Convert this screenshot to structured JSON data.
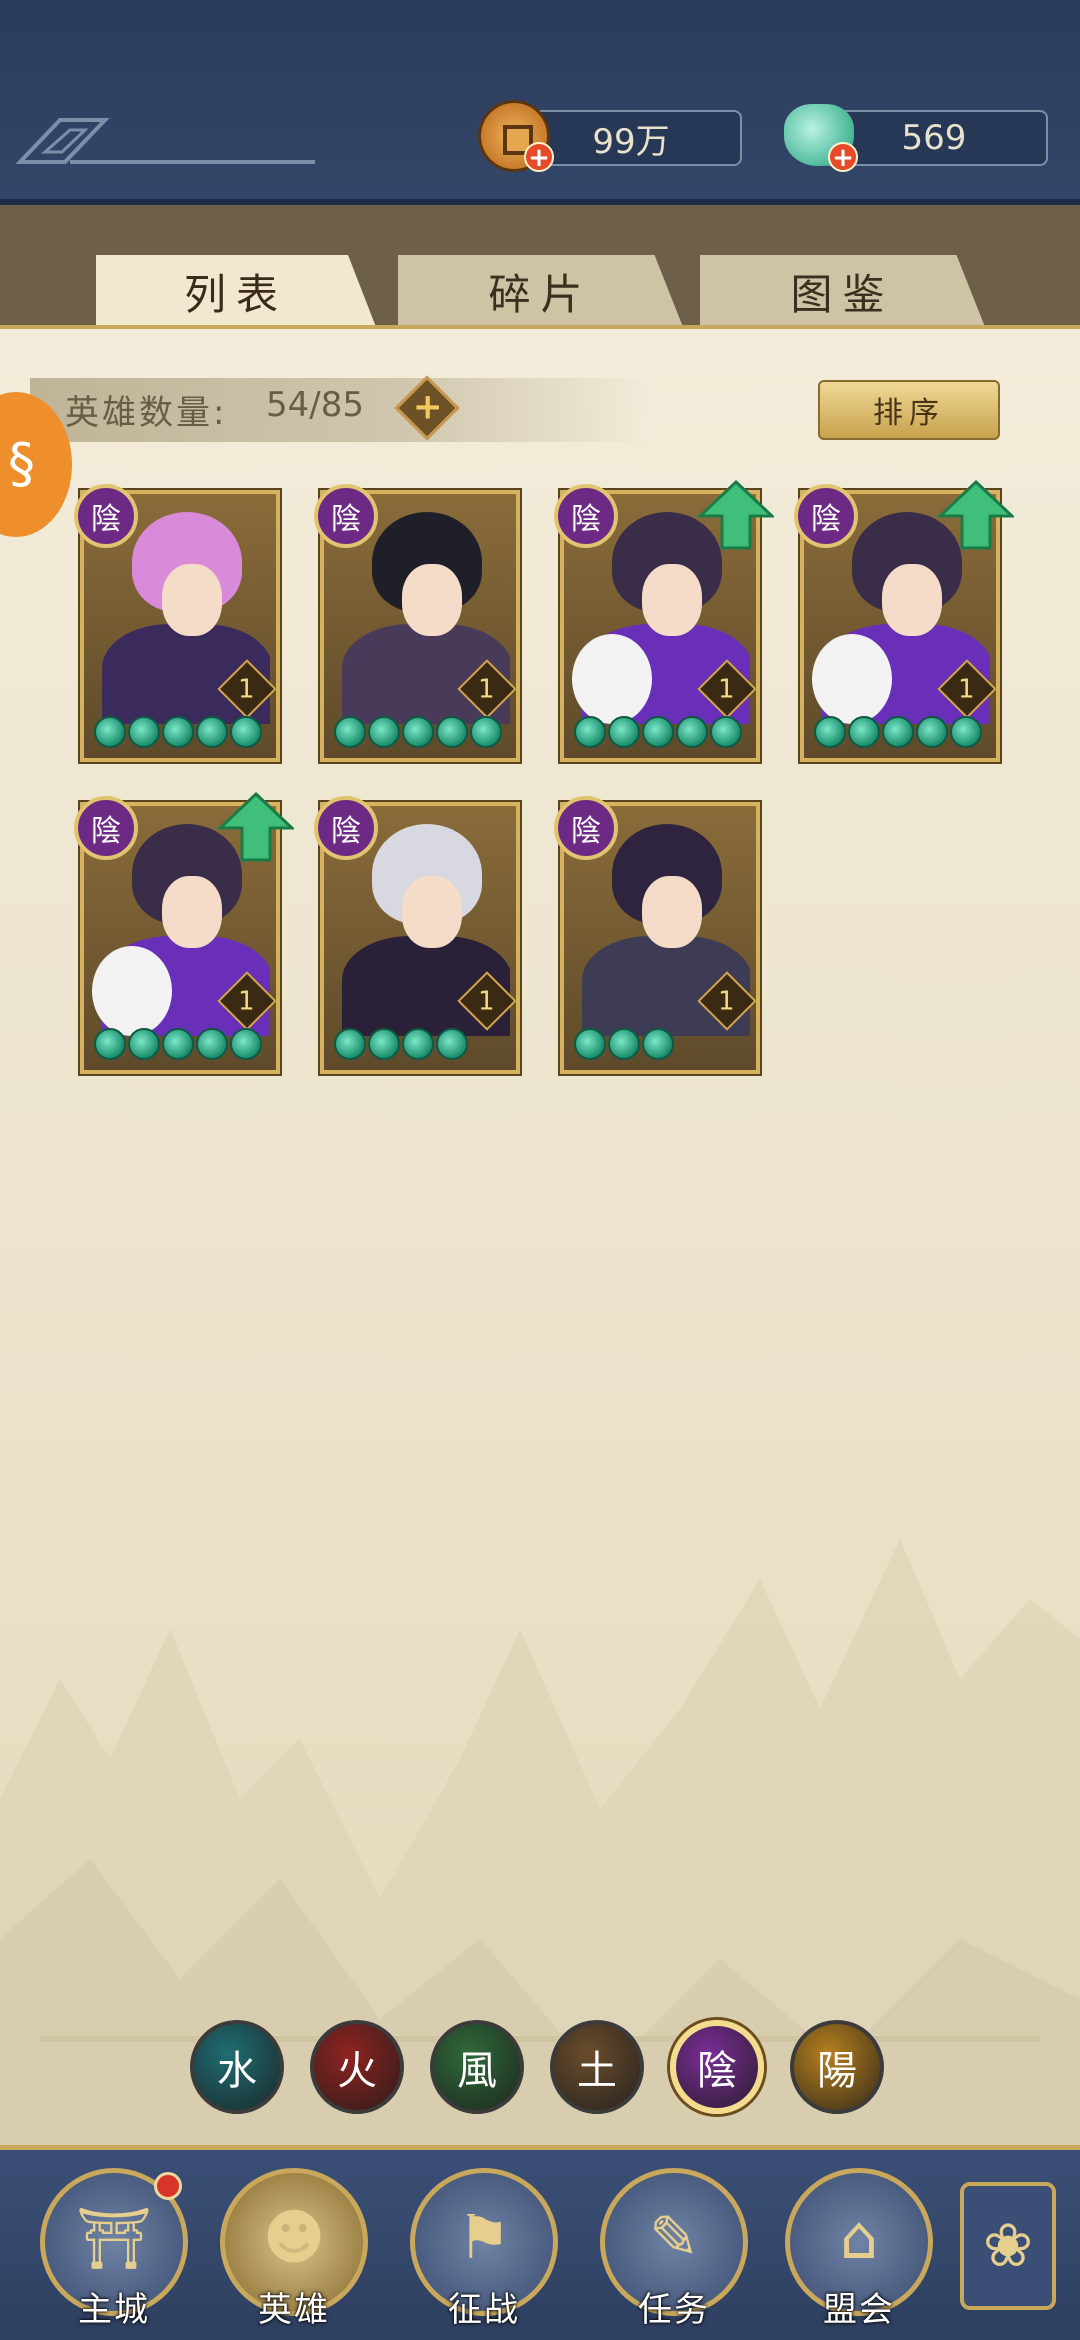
{
  "currency": {
    "coins": "99万",
    "jade": "569"
  },
  "tabs": [
    {
      "label": "列表",
      "active": true
    },
    {
      "label": "碎片",
      "active": false
    },
    {
      "label": "图鉴",
      "active": false
    }
  ],
  "hero_count": {
    "label": "英雄数量:",
    "value": "54/85"
  },
  "sort_label": "排序",
  "heroes": [
    {
      "element": "陰",
      "level": "1",
      "stars": 5,
      "upgrade": false,
      "palette": {
        "hair": "#d98ad8",
        "body": "#3a2b5c"
      }
    },
    {
      "element": "陰",
      "level": "1",
      "stars": 5,
      "upgrade": false,
      "palette": {
        "hair": "#1f1f2a",
        "body": "#4a3a5a"
      }
    },
    {
      "element": "陰",
      "level": "1",
      "stars": 5,
      "upgrade": true,
      "palette": {
        "hair": "#3a2d4a",
        "body": "#6a2fb8"
      }
    },
    {
      "element": "陰",
      "level": "1",
      "stars": 5,
      "upgrade": true,
      "palette": {
        "hair": "#3a2d4a",
        "body": "#6a2fb8"
      }
    },
    {
      "element": "陰",
      "level": "1",
      "stars": 5,
      "upgrade": true,
      "palette": {
        "hair": "#3a2d4a",
        "body": "#6a2fb8"
      }
    },
    {
      "element": "陰",
      "level": "1",
      "stars": 4,
      "upgrade": false,
      "palette": {
        "hair": "#d8d8e0",
        "body": "#2a2138"
      }
    },
    {
      "element": "陰",
      "level": "1",
      "stars": 3,
      "upgrade": false,
      "palette": {
        "hair": "#2e2440",
        "body": "#3e3c55"
      }
    }
  ],
  "element_filters": [
    {
      "glyph": "水",
      "color": "#1f6d73",
      "selected": false
    },
    {
      "glyph": "火",
      "color": "#8e2420",
      "selected": false
    },
    {
      "glyph": "風",
      "color": "#2f6a38",
      "selected": false
    },
    {
      "glyph": "土",
      "color": "#6a4c2c",
      "selected": false
    },
    {
      "glyph": "陰",
      "color": "#7a2d96",
      "selected": true
    },
    {
      "glyph": "陽",
      "color": "#b7801e",
      "selected": false
    }
  ],
  "nav": [
    {
      "label": "主城",
      "icon": "city-gate-icon",
      "glyph": "⛩",
      "active": false
    },
    {
      "label": "英雄",
      "icon": "hero-portrait-icon",
      "glyph": "☻",
      "active": true
    },
    {
      "label": "征战",
      "icon": "campaign-icon",
      "glyph": "⚑",
      "active": false
    },
    {
      "label": "任务",
      "icon": "task-scroll-icon",
      "glyph": "✎",
      "active": false
    },
    {
      "label": "盟会",
      "icon": "guild-hall-icon",
      "glyph": "⌂",
      "active": false
    }
  ],
  "more_icon": "clover-menu-icon",
  "colors": {
    "accent_gold": "#c9a85c",
    "star_jade": "#1b8e6e",
    "notice_red": "#d8352a"
  }
}
